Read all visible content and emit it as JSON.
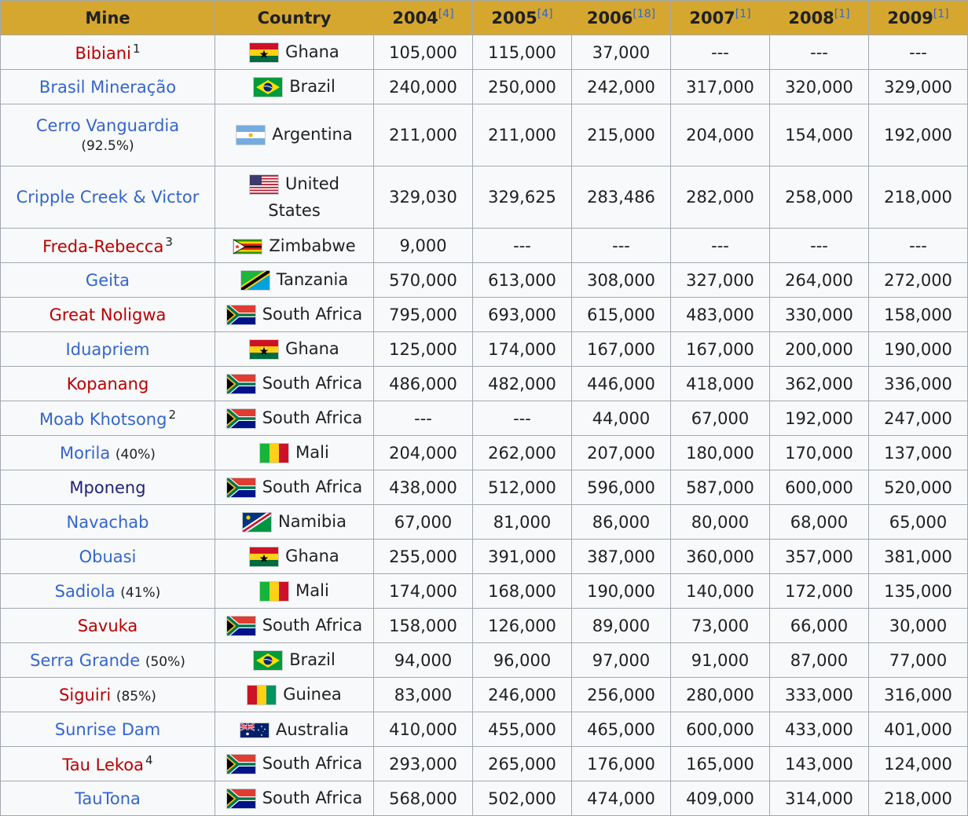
{
  "table": {
    "headers": [
      {
        "label": "Mine",
        "ref": ""
      },
      {
        "label": "Country",
        "ref": ""
      },
      {
        "label": "2004",
        "ref": "[4]"
      },
      {
        "label": "2005",
        "ref": "[4]"
      },
      {
        "label": "2006",
        "ref": "[18]"
      },
      {
        "label": "2007",
        "ref": "[1]"
      },
      {
        "label": "2008",
        "ref": "[1]"
      },
      {
        "label": "2009",
        "ref": "[1]"
      }
    ],
    "rows": [
      {
        "mine": "Bibiani",
        "note": "1",
        "pct": "",
        "country": "Ghana",
        "values": [
          "105,000",
          "115,000",
          "37,000",
          "---",
          "---",
          "---"
        ]
      },
      {
        "mine": "Brasil Mineração",
        "note": "",
        "pct": "",
        "country": "Brazil",
        "values": [
          "240,000",
          "250,000",
          "242,000",
          "317,000",
          "320,000",
          "329,000"
        ]
      },
      {
        "mine": "Cerro Vanguardia",
        "note": "",
        "pct": "(92.5%)",
        "country": "Argentina",
        "values": [
          "211,000",
          "211,000",
          "215,000",
          "204,000",
          "154,000",
          "192,000"
        ]
      },
      {
        "mine": "Cripple Creek & Victor",
        "note": "",
        "pct": "",
        "country": "United States",
        "values": [
          "329,030",
          "329,625",
          "283,486",
          "282,000",
          "258,000",
          "218,000"
        ]
      },
      {
        "mine": "Freda-Rebecca",
        "note": "3",
        "pct": "",
        "country": "Zimbabwe",
        "values": [
          "9,000",
          "---",
          "---",
          "---",
          "---",
          "---"
        ]
      },
      {
        "mine": "Geita",
        "note": "",
        "pct": "",
        "country": "Tanzania",
        "values": [
          "570,000",
          "613,000",
          "308,000",
          "327,000",
          "264,000",
          "272,000"
        ]
      },
      {
        "mine": "Great Noligwa",
        "note": "",
        "pct": "",
        "country": "South Africa",
        "values": [
          "795,000",
          "693,000",
          "615,000",
          "483,000",
          "330,000",
          "158,000"
        ]
      },
      {
        "mine": "Iduapriem",
        "note": "",
        "pct": "",
        "country": "Ghana",
        "values": [
          "125,000",
          "174,000",
          "167,000",
          "167,000",
          "200,000",
          "190,000"
        ]
      },
      {
        "mine": "Kopanang",
        "note": "",
        "pct": "",
        "country": "South Africa",
        "values": [
          "486,000",
          "482,000",
          "446,000",
          "418,000",
          "362,000",
          "336,000"
        ]
      },
      {
        "mine": "Moab Khotsong",
        "note": "2",
        "pct": "",
        "country": "South Africa",
        "values": [
          "---",
          "---",
          "44,000",
          "67,000",
          "192,000",
          "247,000"
        ]
      },
      {
        "mine": "Morila",
        "note": "",
        "pct": "(40%)",
        "country": "Mali",
        "values": [
          "204,000",
          "262,000",
          "207,000",
          "180,000",
          "170,000",
          "137,000"
        ]
      },
      {
        "mine": "Mponeng",
        "note": "",
        "pct": "",
        "country": "South Africa",
        "values": [
          "438,000",
          "512,000",
          "596,000",
          "587,000",
          "600,000",
          "520,000"
        ]
      },
      {
        "mine": "Navachab",
        "note": "",
        "pct": "",
        "country": "Namibia",
        "values": [
          "67,000",
          "81,000",
          "86,000",
          "80,000",
          "68,000",
          "65,000"
        ]
      },
      {
        "mine": "Obuasi",
        "note": "",
        "pct": "",
        "country": "Ghana",
        "values": [
          "255,000",
          "391,000",
          "387,000",
          "360,000",
          "357,000",
          "381,000"
        ]
      },
      {
        "mine": "Sadiola",
        "note": "",
        "pct": "(41%)",
        "country": "Mali",
        "values": [
          "174,000",
          "168,000",
          "190,000",
          "140,000",
          "172,000",
          "135,000"
        ]
      },
      {
        "mine": "Savuka",
        "note": "",
        "pct": "",
        "country": "South Africa",
        "values": [
          "158,000",
          "126,000",
          "89,000",
          "73,000",
          "66,000",
          "30,000"
        ]
      },
      {
        "mine": "Serra Grande",
        "note": "",
        "pct": "(50%)",
        "country": "Brazil",
        "values": [
          "94,000",
          "96,000",
          "97,000",
          "91,000",
          "87,000",
          "77,000"
        ]
      },
      {
        "mine": "Siguiri",
        "note": "",
        "pct": "(85%)",
        "country": "Guinea",
        "values": [
          "83,000",
          "246,000",
          "256,000",
          "280,000",
          "333,000",
          "316,000"
        ]
      },
      {
        "mine": "Sunrise Dam",
        "note": "",
        "pct": "",
        "country": "Australia",
        "values": [
          "410,000",
          "455,000",
          "465,000",
          "600,000",
          "433,000",
          "401,000"
        ]
      },
      {
        "mine": "Tau Lekoa",
        "note": "4",
        "pct": "",
        "country": "South Africa",
        "values": [
          "293,000",
          "265,000",
          "176,000",
          "165,000",
          "143,000",
          "124,000"
        ]
      },
      {
        "mine": "TauTona",
        "note": "",
        "pct": "",
        "country": "South Africa",
        "values": [
          "568,000",
          "502,000",
          "474,000",
          "409,000",
          "314,000",
          "218,000"
        ]
      }
    ]
  },
  "colors": {
    "header_bg": "#d5a72f",
    "link": "#3366cc",
    "redlink": "#ba0000",
    "visited": "#202277"
  }
}
